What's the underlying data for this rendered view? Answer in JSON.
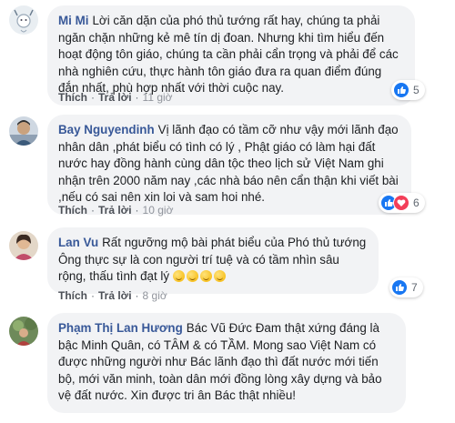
{
  "comments": [
    {
      "author": "Mi Mi",
      "text": "Lời căn dặn của phó thủ tướng rất hay, chúng ta phải ngăn chặn những kẻ mê tín dị đoan. Nhưng khi tìm hiểu đến hoạt động tôn giáo, chúng ta cần phải cẩn trọng và phải để các nhà nghiên cứu, thực hành tôn giáo đưa ra quan điểm đúng đắn nhất, phù hợp nhất với thời cuộc nay.",
      "like_label": "Thích",
      "reply_label": "Trả lời",
      "time": "11 giờ",
      "reaction_count": "5",
      "reactions": [
        "like"
      ]
    },
    {
      "author": "Bay Nguyendinh",
      "text": "Vị lãnh đạo có tầm cỡ như vậy mới lãnh đạo nhân dân ,phát biểu có tình có lý , Phật giáo có làm hại đất nước hay đồng hành cùng dân tộc theo lịch sử Việt Nam ghi nhận trên 2000 năm nay ,các nhà báo nên cẩn thận khi viết bài ,nếu có sai nên xin loi và sam hoi nhé.",
      "like_label": "Thích",
      "reply_label": "Trả lời",
      "time": "10 giờ",
      "reaction_count": "6",
      "reactions": [
        "like",
        "love"
      ]
    },
    {
      "author": "Lan Vu",
      "text": "Rất ngưỡng mộ bài phát biểu của Phó thủ tướng Ông thực sự là con người trí tuệ và có tầm nhìn sâu rộng, thấu tình đạt lý",
      "like_label": "Thích",
      "reply_label": "Trả lời",
      "time": "8 giờ",
      "reaction_count": "7",
      "reactions": [
        "like"
      ],
      "emoji_count": 4
    },
    {
      "author": "Phạm Thị Lan Hương",
      "text": "Bác Vũ Đức Đam thật xứng đáng là bậc Minh Quân, có TÂM & có TẦM. Mong sao Việt Nam có được những người như Bác lãnh đạo thì đất nước mới tiến bộ, mới văn minh, toàn dân mới đồng lòng xây dựng và bảo vệ đất nước. Xin được tri ân Bác thật nhiều!"
    }
  ],
  "colors": {
    "author": "#385898",
    "bubble": "#f2f3f5",
    "like": "#1877f2",
    "love": "#f33e58"
  }
}
